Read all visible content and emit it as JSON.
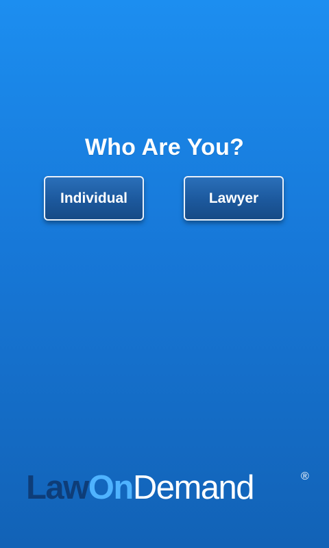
{
  "screen": {
    "title": "Who Are You?"
  },
  "buttons": {
    "individual_label": "Individual",
    "lawyer_label": "Lawyer"
  },
  "logo": {
    "part1": "Law",
    "part2": "On",
    "part3": "Demand",
    "registered_mark": "®"
  },
  "colors": {
    "background_top": "#1c8ef0",
    "background_bottom": "#1262b6",
    "button_fill": "#1d5a9f",
    "button_border": "#e8f0fa",
    "logo_dark": "#0e3d78",
    "logo_light": "#4fb3ff"
  }
}
